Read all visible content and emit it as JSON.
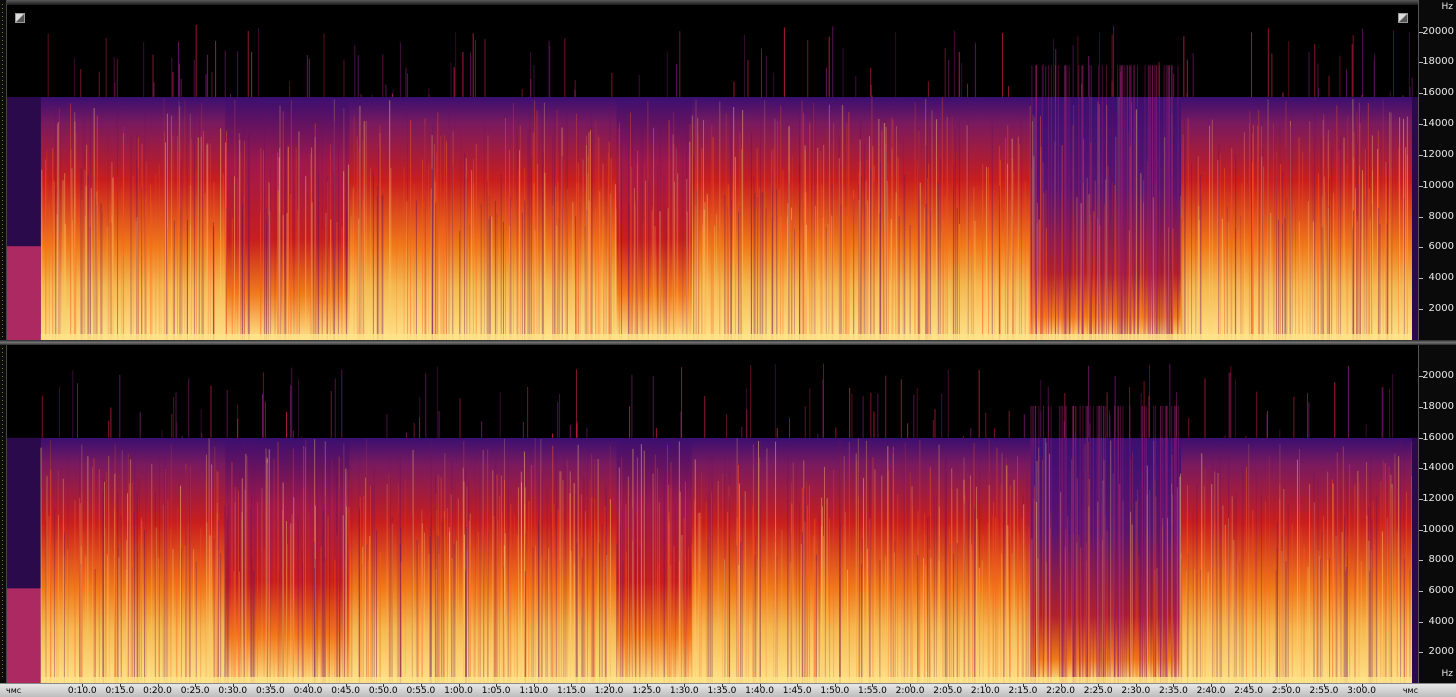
{
  "freq_axis": {
    "unit_label": "Hz",
    "max_hz": 22050,
    "ticks": [
      {
        "value": 20000,
        "label": "20000"
      },
      {
        "value": 18000,
        "label": "18000"
      },
      {
        "value": 16000,
        "label": "16000"
      },
      {
        "value": 14000,
        "label": "14000"
      },
      {
        "value": 12000,
        "label": "12000"
      },
      {
        "value": 10000,
        "label": "10000"
      },
      {
        "value": 8000,
        "label": "8000"
      },
      {
        "value": 6000,
        "label": "6000"
      },
      {
        "value": 4000,
        "label": "4000"
      },
      {
        "value": 2000,
        "label": "2000"
      }
    ]
  },
  "time_ruler": {
    "left_unit": "чмс",
    "right_unit": "чмс",
    "start_seconds": 0,
    "end_seconds": 187.5,
    "ticks": [
      {
        "seconds": 10,
        "label": "0:10.0"
      },
      {
        "seconds": 15,
        "label": "0:15.0"
      },
      {
        "seconds": 20,
        "label": "0:20.0"
      },
      {
        "seconds": 25,
        "label": "0:25.0"
      },
      {
        "seconds": 30,
        "label": "0:30.0"
      },
      {
        "seconds": 35,
        "label": "0:35.0"
      },
      {
        "seconds": 40,
        "label": "0:40.0"
      },
      {
        "seconds": 45,
        "label": "0:45.0"
      },
      {
        "seconds": 50,
        "label": "0:50.0"
      },
      {
        "seconds": 55,
        "label": "0:55.0"
      },
      {
        "seconds": 60,
        "label": "1:00.0"
      },
      {
        "seconds": 65,
        "label": "1:05.0"
      },
      {
        "seconds": 70,
        "label": "1:10.0"
      },
      {
        "seconds": 75,
        "label": "1:15.0"
      },
      {
        "seconds": 80,
        "label": "1:20.0"
      },
      {
        "seconds": 85,
        "label": "1:25.0"
      },
      {
        "seconds": 90,
        "label": "1:30.0"
      },
      {
        "seconds": 95,
        "label": "1:35.0"
      },
      {
        "seconds": 100,
        "label": "1:40.0"
      },
      {
        "seconds": 105,
        "label": "1:45.0"
      },
      {
        "seconds": 110,
        "label": "1:50.0"
      },
      {
        "seconds": 115,
        "label": "1:55.0"
      },
      {
        "seconds": 120,
        "label": "2:00.0"
      },
      {
        "seconds": 125,
        "label": "2:05.0"
      },
      {
        "seconds": 130,
        "label": "2:10.0"
      },
      {
        "seconds": 135,
        "label": "2:15.0"
      },
      {
        "seconds": 140,
        "label": "2:20.0"
      },
      {
        "seconds": 145,
        "label": "2:25.0"
      },
      {
        "seconds": 150,
        "label": "2:30.0"
      },
      {
        "seconds": 155,
        "label": "2:35.0"
      },
      {
        "seconds": 160,
        "label": "2:40.0"
      },
      {
        "seconds": 165,
        "label": "2:45.0"
      },
      {
        "seconds": 170,
        "label": "2:50.0"
      },
      {
        "seconds": 175,
        "label": "2:55.0"
      },
      {
        "seconds": 180,
        "label": "3:00.0"
      }
    ]
  },
  "spectrogram": {
    "channel_count": 2,
    "cutoff_hz": 16000,
    "dip_regions_seconds": [
      [
        29,
        45.5
      ],
      [
        81,
        91
      ],
      [
        136,
        156
      ]
    ],
    "colors": {
      "background": "#000000",
      "low": "#3b0f70",
      "mid": "#c81e1e",
      "high": "#f07a1a",
      "peak": "#ffe38a"
    }
  }
}
